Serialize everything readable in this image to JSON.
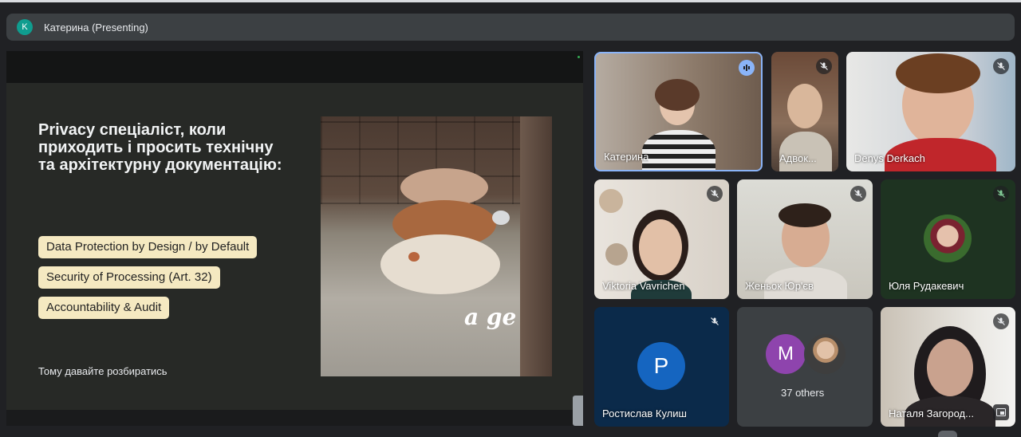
{
  "presenter": {
    "initial": "K",
    "label": "Катерина (Presenting)",
    "avatar_color": "#0f9d8f"
  },
  "slide": {
    "title": "Privacy спеціаліст, коли\nприходить і просить технічну\nта архітектурну документацію:",
    "items": [
      "Data Protection by Design / by Default",
      "Security of Processing (Art. 32)",
      "Accountability & Audit"
    ],
    "footer": "Тому давайте розбиратись",
    "photo_caption": "a ge",
    "pill_color": "#f5e9c1"
  },
  "participants": [
    {
      "name": "Катерина",
      "state": "speaking"
    },
    {
      "name": "Адвок...",
      "state": "muted"
    },
    {
      "name": "Denys Derkach",
      "state": "muted"
    },
    {
      "name": "Viktoria Vavrichen",
      "state": "muted"
    },
    {
      "name": "Женьок Юр'єв",
      "state": "muted"
    },
    {
      "name": "Юля Рудакевич",
      "state": "muted"
    },
    {
      "name": "Ростислав Кулиш",
      "initial": "P",
      "state": "muted",
      "avatar_color": "#1565c0"
    },
    {
      "name": "Наталя Загород...",
      "state": "muted"
    }
  ],
  "others": {
    "initial": "M",
    "label": "37 others",
    "avatar_color": "#8e44ad"
  },
  "colors": {
    "accent_blue": "#8ab4f8",
    "background": "#202124",
    "tile": "#3c4043"
  },
  "icons": [
    "mic-off-icon",
    "audio-bars-icon",
    "screen-share-icon",
    "chevron-up-icon"
  ]
}
